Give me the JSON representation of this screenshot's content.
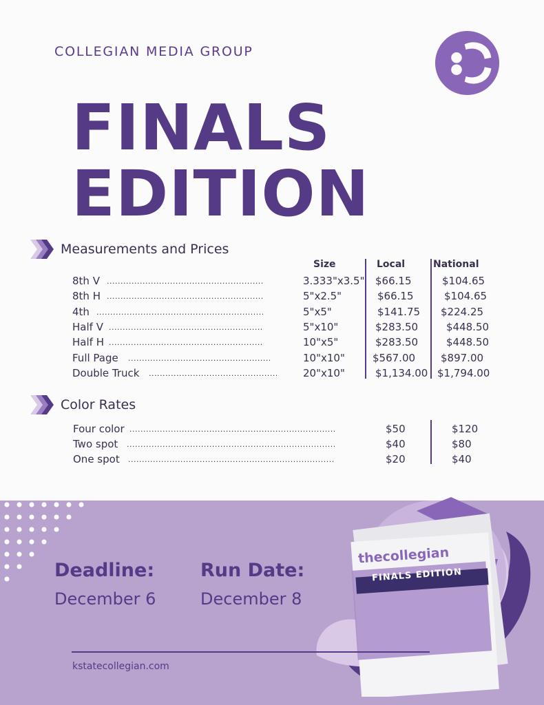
{
  "header": {
    "org": "COLLEGIAN MEDIA GROUP",
    "title_line1": "FINALS",
    "title_line2": "EDITION"
  },
  "measurements": {
    "heading": "Measurements and Prices",
    "columns": [
      "Size",
      "Local",
      "National"
    ],
    "rows": [
      {
        "name": "8th V",
        "size": "3.333\"x3.5\"",
        "local": "$66.15",
        "national": "$104.65"
      },
      {
        "name": "8th H",
        "size": "5\"x2.5\"",
        "local": "$66.15",
        "national": "$104.65"
      },
      {
        "name": "4th",
        "size": "5\"x5\"",
        "local": "$141.75",
        "national": "$224.25"
      },
      {
        "name": "Half V",
        "size": "5\"x10\"",
        "local": "$283.50",
        "national": "$448.50"
      },
      {
        "name": "Half H",
        "size": "10\"x5\"",
        "local": "$283.50",
        "national": "$448.50"
      },
      {
        "name": "Full Page",
        "size": "10\"x10\"",
        "local": "$567.00",
        "national": "$897.00"
      },
      {
        "name": "Double Truck",
        "size": "20\"x10\"",
        "local": "$1,134.00",
        "national": "$1,794.00"
      }
    ]
  },
  "color_rates": {
    "heading": "Color Rates",
    "rows": [
      {
        "name": "Four color",
        "local": "$50",
        "national": "$120"
      },
      {
        "name": "Two spot",
        "local": "$40",
        "national": "$80"
      },
      {
        "name": "One spot",
        "local": "$20",
        "national": "$40"
      }
    ]
  },
  "footer": {
    "deadline_label": "Deadline:",
    "deadline_value": "December 6",
    "rundate_label": "Run Date:",
    "rundate_value": "December 8",
    "url": "kstatecollegian.com",
    "newspaper_masthead": "thecollegian",
    "newspaper_banner": "FINALS EDITION"
  },
  "colors": {
    "primary": "#553a86",
    "footer_bg": "#b8a3cf",
    "light_purple": "#d9c8e6"
  }
}
